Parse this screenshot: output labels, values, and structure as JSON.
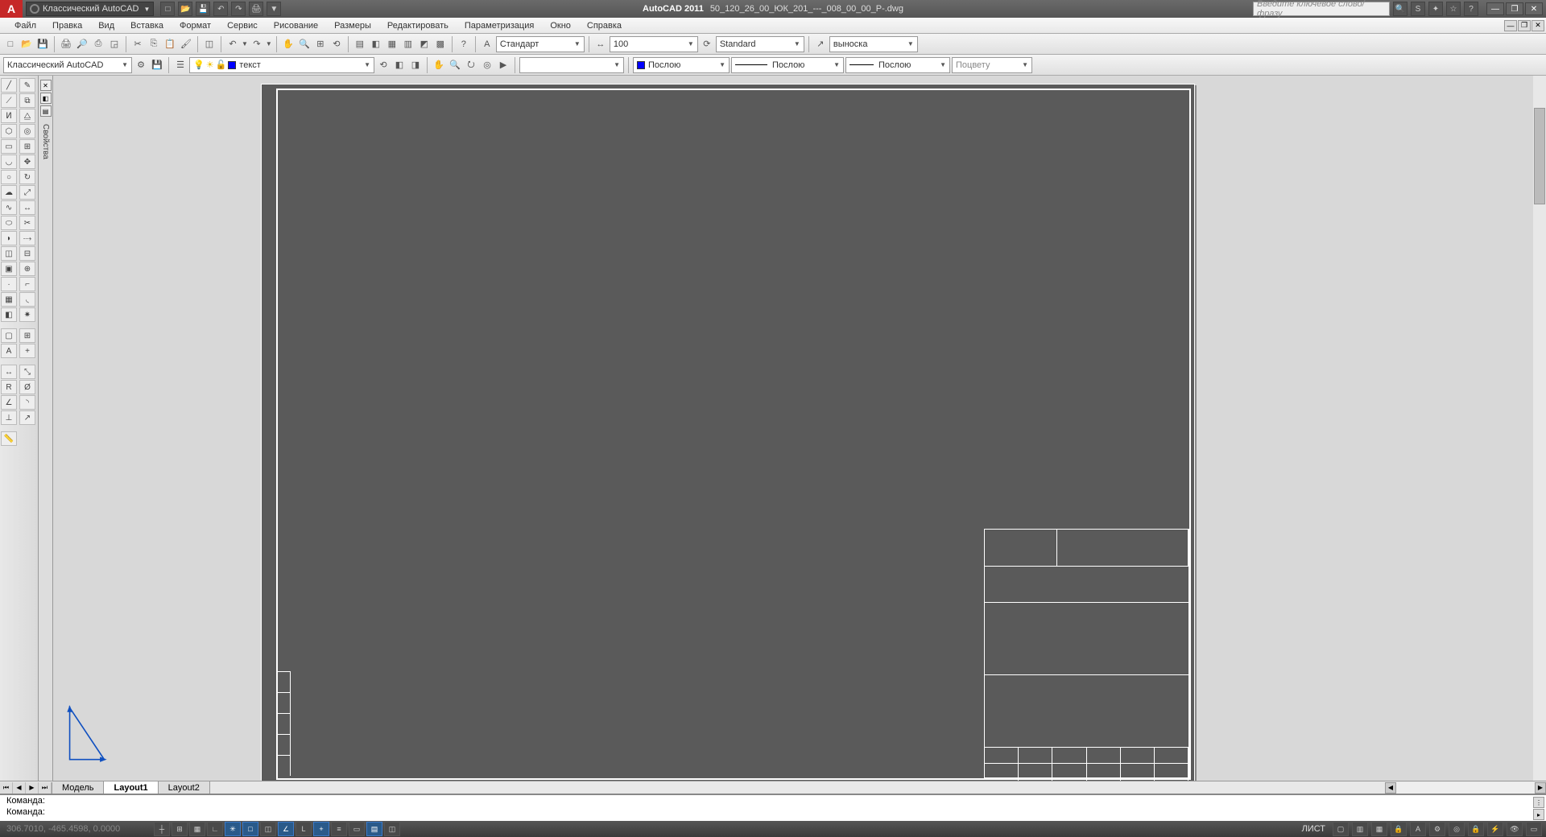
{
  "title_bar": {
    "workspace_label": "Классический AutoCAD",
    "app_name": "AutoCAD 2011",
    "doc_name": "50_120_26_00_ЮК_201_---_008_00_00_Р-.dwg",
    "search_placeholder": "Введите ключевое слово/фразу"
  },
  "menu": [
    "Файл",
    "Правка",
    "Вид",
    "Вставка",
    "Формат",
    "Сервис",
    "Рисование",
    "Размеры",
    "Редактировать",
    "Параметризация",
    "Окно",
    "Справка"
  ],
  "row2": {
    "text_style": "Стандарт",
    "dim_scale": "100",
    "dim_style": "Standard",
    "mleader_style": "выноска"
  },
  "row3": {
    "workspace_switch": "Классический AutoCAD",
    "layer_name": "текст",
    "color": "Послою",
    "linetype": "Послою",
    "lineweight": "Послою",
    "plotstyle": "Поцвету"
  },
  "palette": {
    "label": "Свойства"
  },
  "tabs": {
    "model": "Модель",
    "layout1": "Layout1",
    "layout2": "Layout2"
  },
  "cmd": {
    "line1": "Команда:",
    "line2": "Команда:"
  },
  "status": {
    "coords": "306.7010, -465.4598, 0.0000",
    "space": "ЛИСТ"
  }
}
